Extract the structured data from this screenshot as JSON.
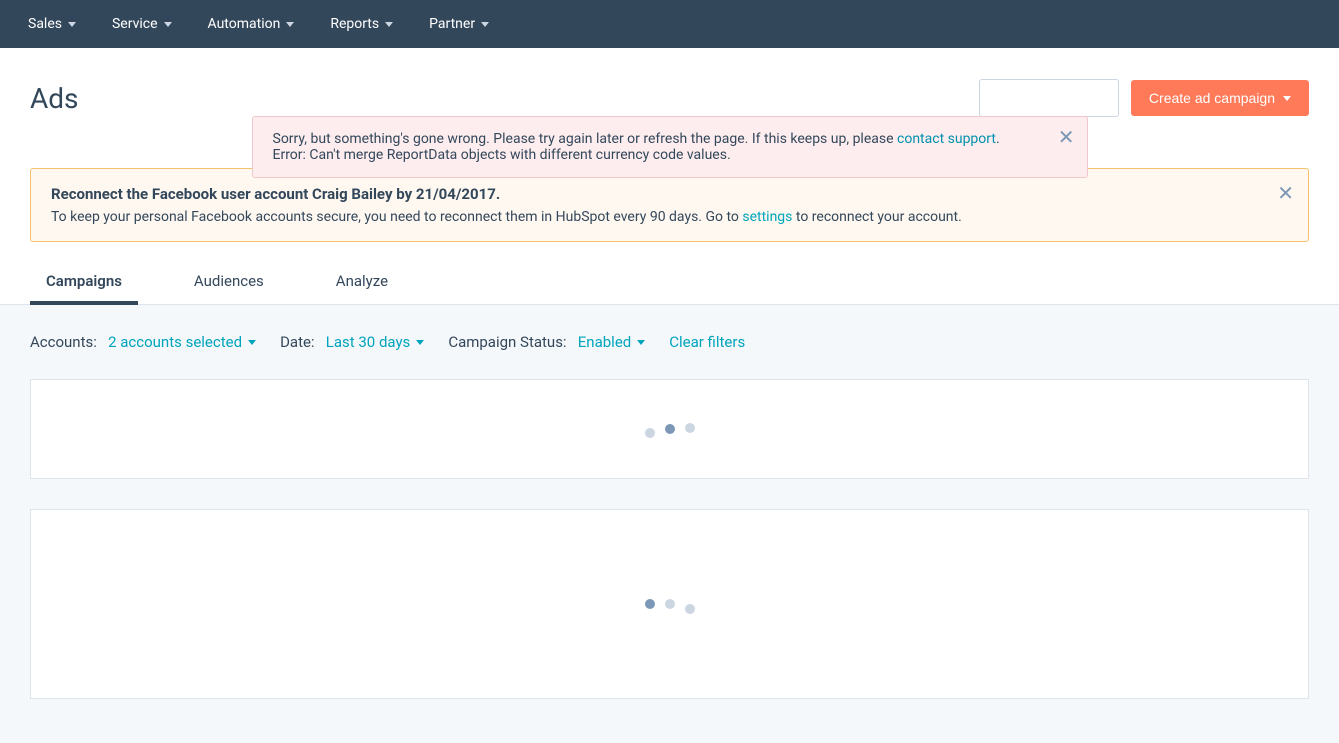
{
  "nav": {
    "items": [
      {
        "label": "Sales"
      },
      {
        "label": "Service"
      },
      {
        "label": "Automation"
      },
      {
        "label": "Reports"
      },
      {
        "label": "Partner"
      }
    ]
  },
  "page": {
    "title": "Ads",
    "create_button": "Create ad campaign"
  },
  "error": {
    "line1_a": "Sorry, but something's gone wrong. Please try again later or refresh the page. If this keeps up, please ",
    "link": "contact support",
    "line1_b": ".",
    "line2": "Error: Can't merge ReportData objects with different currency code values."
  },
  "warn": {
    "title": "Reconnect the Facebook user account Craig Bailey by 21/04/2017.",
    "body_a": "To keep your personal Facebook accounts secure, you need to reconnect them in HubSpot every 90 days. Go to ",
    "link": "settings",
    "body_b": " to reconnect your account."
  },
  "tabs": {
    "items": [
      {
        "label": "Campaigns",
        "active": true
      },
      {
        "label": "Audiences",
        "active": false
      },
      {
        "label": "Analyze",
        "active": false
      }
    ]
  },
  "filters": {
    "accounts_label": "Accounts:",
    "accounts_value": "2 accounts selected",
    "date_label": "Date:",
    "date_value": "Last 30 days",
    "status_label": "Campaign Status:",
    "status_value": "Enabled",
    "clear": "Clear filters"
  }
}
